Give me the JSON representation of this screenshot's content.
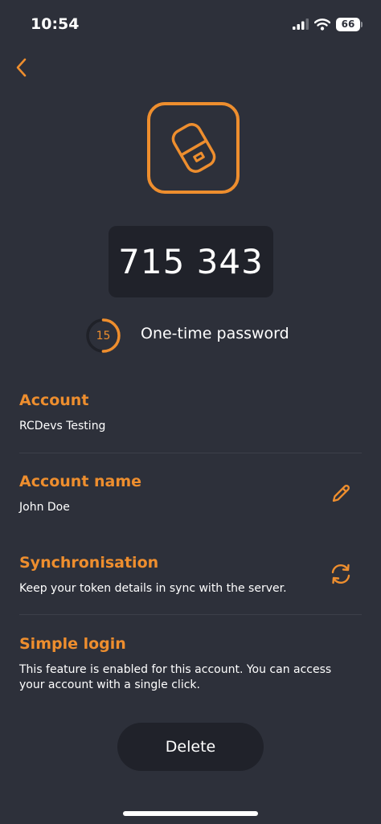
{
  "status_bar": {
    "time": "10:54",
    "battery": "66"
  },
  "icons": {
    "back": "chevron-left-icon",
    "token": "token-device-icon",
    "edit": "pencil-icon",
    "sync": "sync-icon"
  },
  "colors": {
    "background": "#2d303a",
    "accent": "#ee8e2e",
    "surface": "#20222a"
  },
  "otp": {
    "code": "715 343",
    "timer_seconds": "15",
    "timer_progress": 0.5,
    "label": "One-time password"
  },
  "sections": {
    "account": {
      "title": "Account",
      "value": "RCDevs Testing"
    },
    "account_name": {
      "title": "Account name",
      "value": "John Doe"
    },
    "synchronisation": {
      "title": "Synchronisation",
      "value": "Keep your token details in sync with the server."
    },
    "simple_login": {
      "title": "Simple login",
      "value": "This feature is enabled for this account. You can access your account with a single click."
    }
  },
  "delete_label": "Delete"
}
